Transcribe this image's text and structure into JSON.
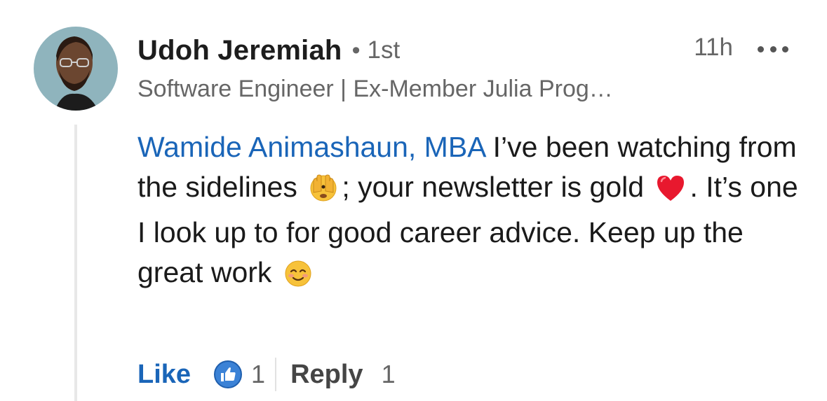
{
  "author": {
    "name": "Udoh Jeremiah",
    "separator": "•",
    "connection_degree": "1st",
    "headline": "Software Engineer | Ex-Member Julia Prog…"
  },
  "timestamp": "11h",
  "more_options_icon": "more-horizontal-icon",
  "comment": {
    "mention": "Wamide Animashaun, MBA",
    "segment_1": " I’ve been watching from the sidelines",
    "emoji_1": "face-with-hands-over-eyes",
    "segment_2": "; your newsletter is gold",
    "emoji_2": "red-heart",
    "segment_3": ". It’s one I look up to for good career advice. Keep up the great work",
    "emoji_3": "smiling-face"
  },
  "actions": {
    "like_label": "Like",
    "reaction_icon": "thumbs-up-icon",
    "like_count": "1",
    "reply_label": "Reply",
    "reply_count": "1"
  },
  "colors": {
    "mention": "#1a65b8",
    "like": "#1a65b8",
    "secondary_text": "#666666",
    "thread_line": "#e8e8e8"
  }
}
